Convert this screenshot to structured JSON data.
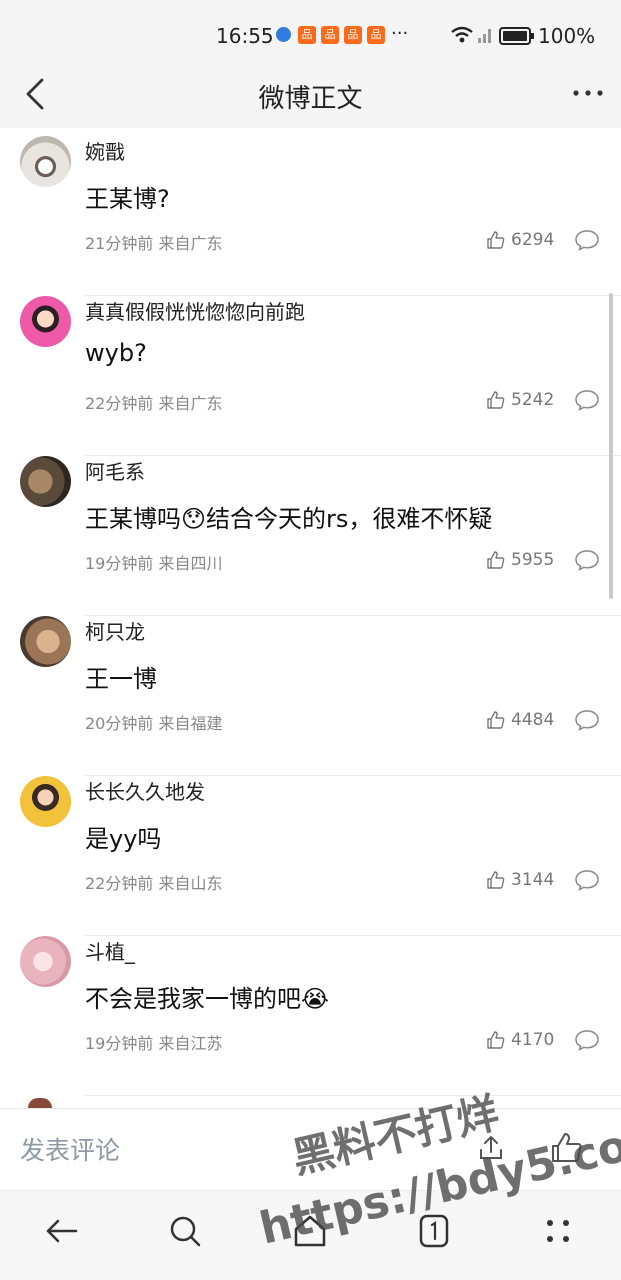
{
  "status_bar": {
    "time": "16:55",
    "app_icon_glyph": "品",
    "overflow": "···",
    "battery_percent": "100%"
  },
  "header": {
    "title": "微博正文"
  },
  "comments": [
    {
      "username": "婉戬",
      "text": "王某博?",
      "time": "21分钟前",
      "location": "来自广东",
      "likes": "6294",
      "avatar_color": "#d9d5d0"
    },
    {
      "username": "真真假假恍恍惚惚向前跑",
      "text": "wyb?",
      "time": "22分钟前",
      "location": "来自广东",
      "likes": "5242",
      "avatar_color": "#e94c9b"
    },
    {
      "username": "阿毛系",
      "text": "王某博吗",
      "text_emoji": "😯",
      "text_after": "结合今天的rs，很难不怀疑",
      "time": "19分钟前",
      "location": "来自四川",
      "likes": "5955",
      "avatar_color": "#6b5a48"
    },
    {
      "username": "柯只龙",
      "text": "王一博",
      "time": "20分钟前",
      "location": "来自福建",
      "likes": "4484",
      "avatar_color": "#b08a6a"
    },
    {
      "username": "长长久久地发",
      "text": "是yy吗",
      "time": "22分钟前",
      "location": "来自山东",
      "likes": "3144",
      "avatar_color": "#f2c23a"
    },
    {
      "username": "斗植_",
      "text": "不会是我家一博的吧",
      "text_emoji": "😭",
      "time": "19分钟前",
      "location": "来自江苏",
      "likes": "4170",
      "avatar_color": "#efc9cf"
    }
  ],
  "compose": {
    "placeholder": "发表评论"
  },
  "watermark": {
    "line1": "黑料不打烊",
    "line2": "https://bdy5.co"
  },
  "colors": {
    "header_bg": "#f5f5f5",
    "meta_text": "#888888",
    "placeholder": "#8d9aa6"
  }
}
